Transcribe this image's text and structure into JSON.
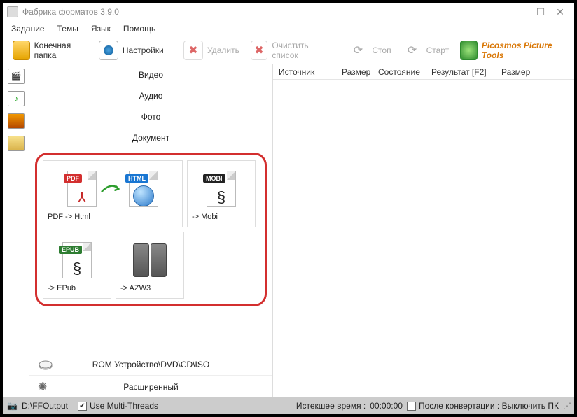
{
  "title": "Фабрика форматов 3.9.0",
  "menu": {
    "task": "Задание",
    "skins": "Темы",
    "lang": "Язык",
    "help": "Помощь"
  },
  "toolbar": {
    "output": "Конечная папка",
    "options": "Настройки",
    "remove": "Удалить",
    "clear": "Очистить список",
    "stop": "Стоп",
    "start": "Старт",
    "picosmos": "Picosmos Picture Tools"
  },
  "cats": {
    "video": "Видео",
    "audio": "Аудио",
    "photo": "Фото",
    "doc": "Документ"
  },
  "tiles": {
    "pdf_html": "PDF -> Html",
    "mobi": "-> Mobi",
    "epub": "-> EPub",
    "azw3": "-> AZW3",
    "badges": {
      "pdf": "PDF",
      "html": "HTML",
      "mobi": "MOBI",
      "epub": "EPUB"
    }
  },
  "bottom": {
    "rom": "ROM Устройство\\DVD\\CD\\ISO",
    "adv": "Расширенный"
  },
  "columns": {
    "src": "Источник",
    "size": "Размер",
    "state": "Состояние",
    "result": "Результат [F2]",
    "size2": "Размер"
  },
  "status": {
    "output_path": "D:\\FFOutput",
    "threads": "Use Multi-Threads",
    "elapsed_label": "Истекшее время :",
    "elapsed_val": "00:00:00",
    "after": "После конвертации : Выключить ПК"
  }
}
